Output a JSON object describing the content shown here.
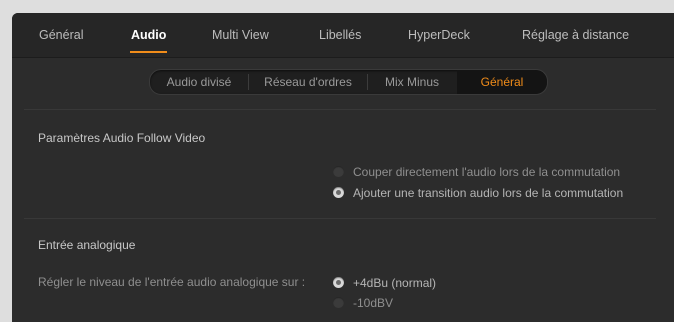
{
  "top_tabs": [
    {
      "label": "Général",
      "active": false
    },
    {
      "label": "Audio",
      "active": true
    },
    {
      "label": "Multi View",
      "active": false
    },
    {
      "label": "Libellés",
      "active": false
    },
    {
      "label": "HyperDeck",
      "active": false
    },
    {
      "label": "Réglage à distance",
      "active": false
    }
  ],
  "sub_tabs": [
    {
      "label": "Audio divisé",
      "active": false
    },
    {
      "label": "Réseau d'ordres",
      "active": false
    },
    {
      "label": "Mix Minus",
      "active": false
    },
    {
      "label": "Général",
      "active": true
    }
  ],
  "afv": {
    "title": "Paramètres Audio Follow Video",
    "options": [
      {
        "label": "Couper directement l'audio lors de la commutation",
        "checked": false
      },
      {
        "label": "Ajouter une transition audio lors de la commutation",
        "checked": true
      }
    ]
  },
  "analog": {
    "title": "Entrée analogique",
    "level_label": "Régler le niveau de l'entrée audio analogique sur :",
    "options": [
      {
        "label": "+4dBu (normal)",
        "checked": true
      },
      {
        "label": "-10dBV",
        "checked": false
      }
    ]
  },
  "colors": {
    "accent": "#f08c1a",
    "panel": "#2c2c2c",
    "nav": "#262626"
  }
}
